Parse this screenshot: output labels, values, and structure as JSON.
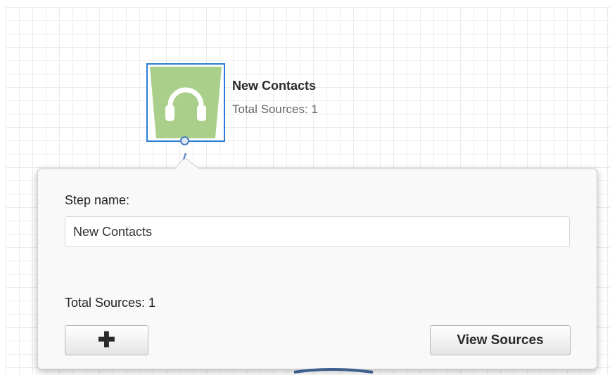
{
  "node": {
    "title": "New Contacts",
    "subtitle": "Total Sources: 1",
    "icon": "headphones-icon",
    "fill_color": "#a9cf8b",
    "selected_border_color": "#2a7fd4"
  },
  "panel": {
    "step_label": "Step name:",
    "step_name_value": "New Contacts",
    "total_sources_text": "Total Sources: 1",
    "add_button_icon": "plus-icon",
    "add_button_glyph": "✚",
    "view_sources_label": "View Sources"
  }
}
